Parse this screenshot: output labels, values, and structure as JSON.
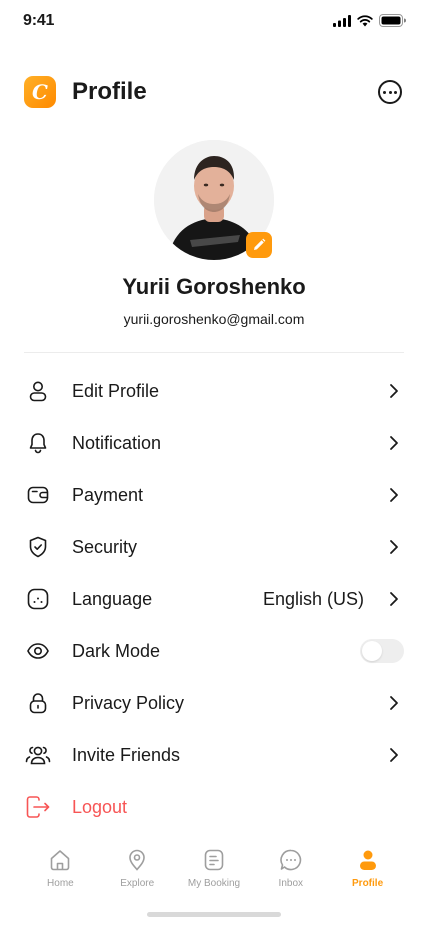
{
  "status_bar": {
    "time": "9:41"
  },
  "header": {
    "logo_letter": "C",
    "title": "Profile"
  },
  "profile": {
    "name": "Yurii Goroshenko",
    "email": "yurii.goroshenko@gmail.com"
  },
  "menu": {
    "edit_profile": "Edit Profile",
    "notification": "Notification",
    "payment": "Payment",
    "security": "Security",
    "language": "Language",
    "language_value": "English (US)",
    "dark_mode": "Dark Mode",
    "dark_mode_enabled": false,
    "privacy_policy": "Privacy Policy",
    "invite_friends": "Invite Friends",
    "logout": "Logout"
  },
  "tabs": [
    {
      "label": "Home",
      "icon": "home-icon",
      "active": false
    },
    {
      "label": "Explore",
      "icon": "location-pin-icon",
      "active": false
    },
    {
      "label": "My Booking",
      "icon": "document-icon",
      "active": false
    },
    {
      "label": "Inbox",
      "icon": "chat-icon",
      "active": false
    },
    {
      "label": "Profile",
      "icon": "user-icon",
      "active": true
    }
  ],
  "colors": {
    "accent": "#ff9a0d",
    "danger": "#f75555",
    "text": "#1a1a1a",
    "muted": "#9e9e9e"
  }
}
